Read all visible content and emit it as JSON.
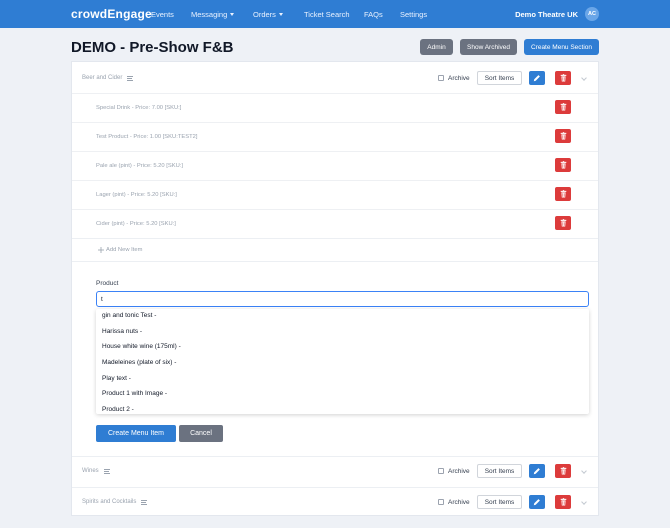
{
  "nav": {
    "brand": "crowdEngage",
    "items": [
      "Events",
      "Messaging",
      "Orders",
      "Ticket Search",
      "FAQs",
      "Settings"
    ],
    "theatre": "Demo Theatre UK",
    "avatar_initials": "AC"
  },
  "header": {
    "title": "DEMO - Pre-Show F&B",
    "admin_label": "Admin",
    "show_archived_label": "Show Archived",
    "create_section_label": "Create Menu Section"
  },
  "sections": {
    "beer": {
      "name": "Beer and Cider",
      "archive_label": "Archive",
      "sort_label": "Sort Items",
      "items": [
        "Special Drink - Price: 7.00 [SKU:]",
        "Test Product - Price: 1.00 [SKU:TEST2]",
        "Pale ale (pint) - Price: 5.20 [SKU:]",
        "Lager (pint) - Price: 5.20 [SKU:]",
        "Cider (pint) - Price: 5.20 [SKU:]"
      ],
      "add_item_label": "Add New Item"
    },
    "wines": {
      "name": "Wines",
      "archive_label": "Archive",
      "sort_label": "Sort Items"
    },
    "spirits": {
      "name": "Spirits and Cocktails",
      "archive_label": "Archive",
      "sort_label": "Sort Items"
    }
  },
  "form": {
    "product_label": "Product",
    "product_value": "t",
    "options": [
      "gin and tonic Test -",
      "Harissa nuts -",
      "House white wine (175ml) -",
      "Madeleines (plate of six) -",
      "Play text -",
      "Product 1 with Image -",
      "Product 2 -"
    ],
    "create_label": "Create Menu Item",
    "cancel_label": "Cancel"
  },
  "colors": {
    "primary": "#2f7dd3",
    "danger": "#dc3b3b",
    "secondary": "#6b7280"
  },
  "icons": [
    "chevron-down-icon",
    "menu-lines-icon",
    "pencil-icon",
    "trash-icon",
    "plus-icon"
  ]
}
